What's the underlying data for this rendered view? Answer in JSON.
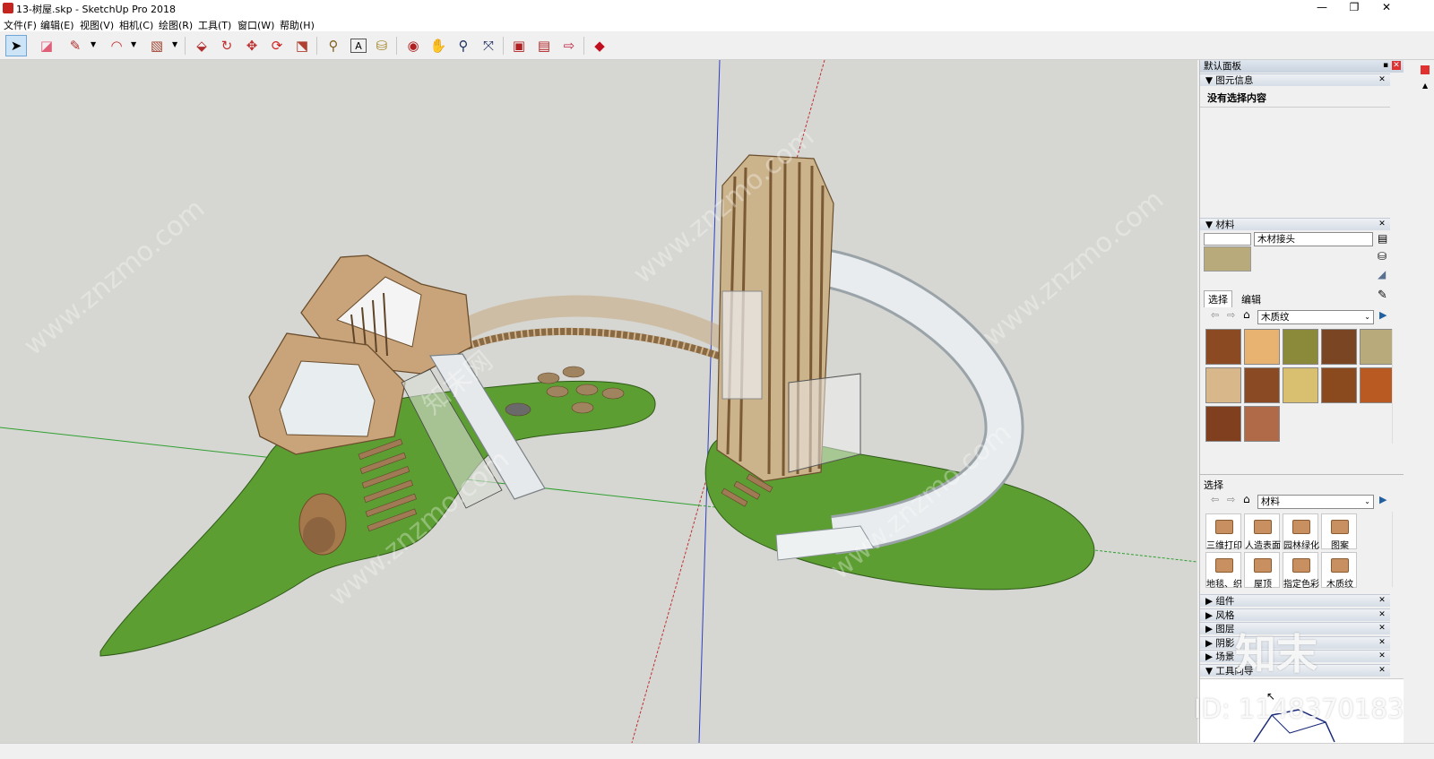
{
  "window": {
    "title": "13-树屋.skp - SketchUp Pro 2018",
    "minimize": "—",
    "maximize": "❐",
    "close": "✕"
  },
  "menu": [
    "文件(F)",
    "编辑(E)",
    "视图(V)",
    "相机(C)",
    "绘图(R)",
    "工具(T)",
    "窗口(W)",
    "帮助(H)"
  ],
  "toolbar": [
    {
      "name": "select-tool",
      "icon": "arrow-cursor-icon",
      "glyph": "➤"
    },
    {
      "name": "eraser-tool",
      "icon": "eraser-icon",
      "glyph": "◪"
    },
    {
      "name": "pencil-tool",
      "icon": "pencil-icon",
      "glyph": "✎"
    },
    {
      "name": "arc-tool",
      "icon": "arc-icon",
      "glyph": "◠"
    },
    {
      "name": "rectangle-tool",
      "icon": "rectangle-icon",
      "glyph": "▧"
    },
    {
      "name": "push-pull-tool",
      "icon": "push-pull-icon",
      "glyph": "⬙"
    },
    {
      "name": "follow-me-tool",
      "icon": "follow-me-icon",
      "glyph": "↻"
    },
    {
      "name": "move-tool",
      "icon": "move-icon",
      "glyph": "✥"
    },
    {
      "name": "rotate-tool",
      "icon": "rotate-icon",
      "glyph": "⟳"
    },
    {
      "name": "scale-tool",
      "icon": "scale-icon",
      "glyph": "⬔"
    },
    {
      "name": "tape-measure-tool",
      "icon": "tape-measure-icon",
      "glyph": "⚲"
    },
    {
      "name": "text-tool",
      "icon": "text-icon",
      "glyph": "A"
    },
    {
      "name": "paint-bucket-tool",
      "icon": "paint-bucket-icon",
      "glyph": "⛁"
    },
    {
      "name": "orbit-tool",
      "icon": "orbit-icon",
      "glyph": "◉"
    },
    {
      "name": "pan-tool",
      "icon": "hand-icon",
      "glyph": "✋"
    },
    {
      "name": "zoom-tool",
      "icon": "magnifier-icon",
      "glyph": "⚲"
    },
    {
      "name": "zoom-extents-tool",
      "icon": "zoom-extents-icon",
      "glyph": "⤧"
    },
    {
      "name": "3d-warehouse-tool",
      "icon": "warehouse-icon",
      "glyph": "▣"
    },
    {
      "name": "extension-warehouse-tool",
      "icon": "extension-icon",
      "glyph": "▤"
    },
    {
      "name": "layout-send-tool",
      "icon": "send-to-layout-icon",
      "glyph": "⇨"
    },
    {
      "name": "ruby-tool",
      "icon": "ruby-icon",
      "glyph": "◆"
    }
  ],
  "colors": {
    "ground": "#d6d6d2",
    "grass": "#5c9e32",
    "wood": "#b58b5c",
    "slide": "#e4e8ea",
    "panel_header": "#c8d2de"
  },
  "panel": {
    "title": "默认面板",
    "entity_info": {
      "heading": "图元信息",
      "text": "没有选择内容"
    },
    "materials": {
      "heading": "材料",
      "name": "木材接头",
      "tabs": [
        "选择",
        "编辑"
      ],
      "library": "木质纹",
      "swatches": [
        "#8c4a22",
        "#e8b270",
        "#8a8a3a",
        "#7a4522",
        "#b8aa7a",
        "#d8b88a",
        "#8a4a24",
        "#d8c070",
        "#8a4a1e",
        "#b85a22",
        "#804020",
        "#b06a48"
      ]
    },
    "select": {
      "heading": "选择",
      "dropdown": "材料",
      "folders": [
        "三维打印",
        "人造表面",
        "园林绿化",
        "图案",
        "地毯、织",
        "屋顶",
        "指定色彩",
        "木质纹"
      ]
    },
    "collapsed": [
      "组件",
      "风格",
      "图层",
      "阴影",
      "场景",
      "工具向导"
    ]
  },
  "watermarks": {
    "site": "www.znzmo.com",
    "brand": "知末",
    "id": "ID: 1148370183",
    "brand_cn": "知末网"
  }
}
